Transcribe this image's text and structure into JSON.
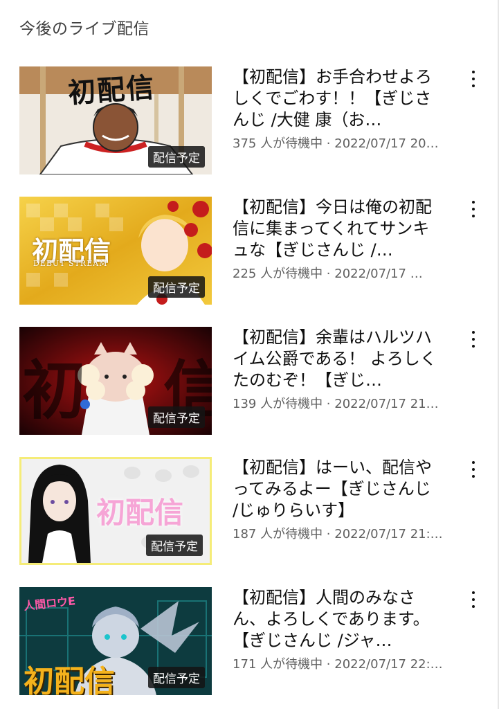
{
  "section": {
    "title": "今後のライブ配信"
  },
  "videos": [
    {
      "title": "【初配信】お手合わせよろしくでごわす！！【ぎじさんじ /大健 康（お…",
      "meta": "375 人が待機中 · 2022/07/17 20…",
      "badge": "配信予定",
      "thumb_text": "初配信"
    },
    {
      "title": "【初配信】今日は俺の初配信に集まってくれてサンキュな【ぎじさんじ /…",
      "meta": "225 人が待機中 · 2022/07/17 …",
      "badge": "配信予定",
      "thumb_text": "初配信",
      "thumb_sub": "DEBUT STREAM"
    },
    {
      "title": "【初配信】余輩はハルツハイム公爵である！ よろしくたのむぞ！【ぎじ…",
      "meta": "139 人が待機中 · 2022/07/17 21…",
      "badge": "配信予定",
      "thumb_text": "初 信"
    },
    {
      "title": "【初配信】はーい、配信やってみるよー【ぎじさんじ /じゅりらいす】",
      "meta": "187 人が待機中 · 2022/07/17 21:…",
      "badge": "配信予定",
      "thumb_text": "初配信"
    },
    {
      "title": "【初配信】人間のみなさん、よろしくであります。【ぎじさんじ /ジャ…",
      "meta": "171 人が待機中 · 2022/07/17 22:…",
      "badge": "配信予定",
      "thumb_text": "初配信",
      "thumb_top": "人間ロウE"
    }
  ]
}
